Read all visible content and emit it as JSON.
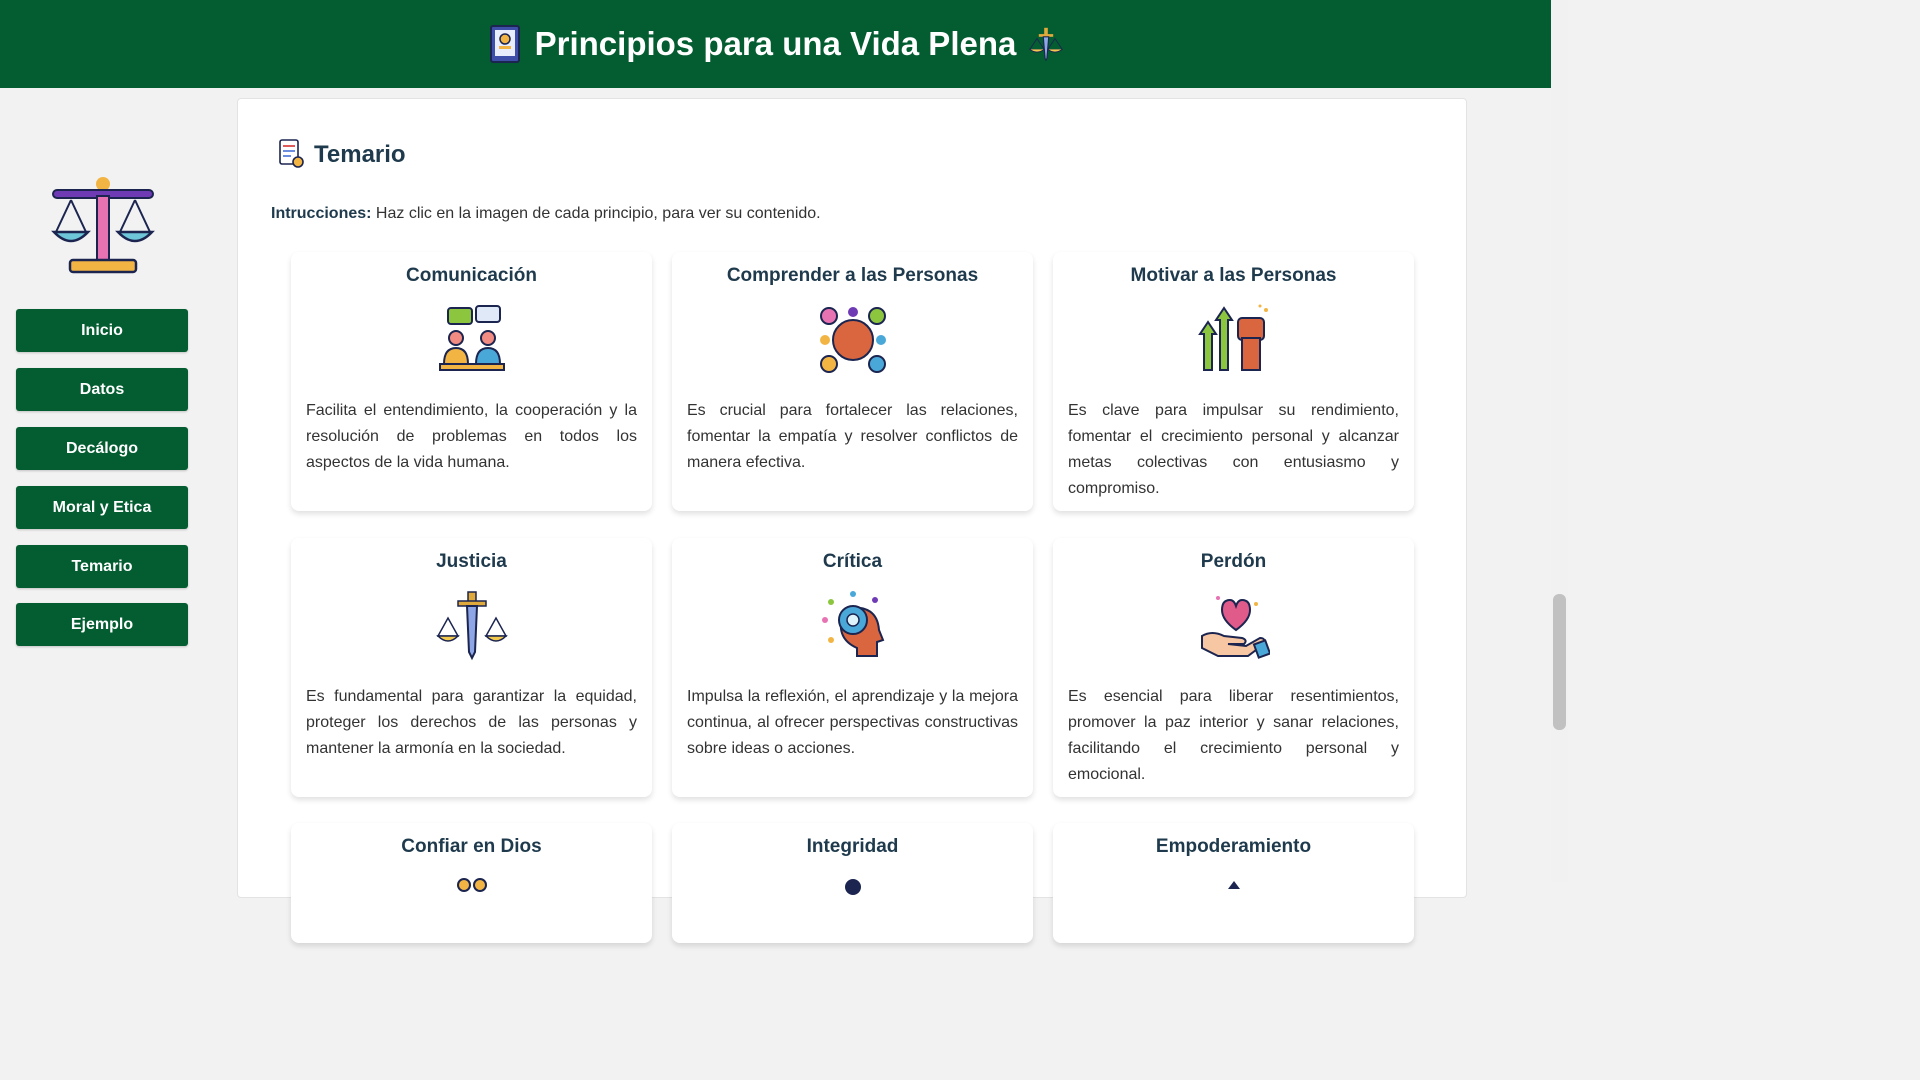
{
  "header": {
    "title": "Principios para una Vida Plena",
    "left_icon": "book-icon",
    "right_icon": "justice-sword-icon"
  },
  "sidebar": {
    "logo": "scale-icon",
    "items": [
      {
        "label": "Inicio"
      },
      {
        "label": "Datos"
      },
      {
        "label": "Decálogo"
      },
      {
        "label": "Moral y Etica"
      },
      {
        "label": "Temario"
      },
      {
        "label": "Ejemplo"
      }
    ]
  },
  "main": {
    "title": "Temario",
    "title_icon": "document-icon",
    "instructions_label": "Intrucciones:",
    "instructions_text": " Haz clic en la imagen de cada principio, para ver su contenido.",
    "cards": [
      {
        "title": "Comunicación",
        "icon": "conversation-icon",
        "text": "Facilita el entendimiento, la cooperación y la resolución de problemas en todos los aspectos de la vida humana."
      },
      {
        "title": "Comprender a las Personas",
        "icon": "connected-hands-icon",
        "text": "Es crucial para fortalecer las relaciones, fomentar la empatía y resolver conflictos de manera efectiva."
      },
      {
        "title": "Motivar a las Personas",
        "icon": "raised-fist-arrows-icon",
        "text": "Es clave para impulsar su rendimiento, fomentar el crecimiento personal y alcanzar metas colectivas con entusiasmo y compromiso."
      },
      {
        "title": "Justicia",
        "icon": "sword-scale-icon",
        "text": "Es fundamental para garantizar la equidad, proteger los derechos de las personas y mantener la armonía en la sociedad."
      },
      {
        "title": "Crítica",
        "icon": "head-gear-icon",
        "text": "Impulsa la reflexión, el aprendizaje y la mejora continua, al ofrecer perspectivas constructivas sobre ideas o acciones."
      },
      {
        "title": "Perdón",
        "icon": "heart-hand-icon",
        "text": "Es esencial para liberar resentimientos, promover la paz interior y sanar relaciones, facilitando el crecimiento personal y emocional."
      },
      {
        "title": "Confiar en Dios",
        "icon": "praying-icon",
        "text": ""
      },
      {
        "title": "Integridad",
        "icon": "integrity-icon",
        "text": ""
      },
      {
        "title": "Empoderamiento",
        "icon": "empowerment-icon",
        "text": ""
      }
    ]
  },
  "colors": {
    "brand_green": "#035d31",
    "title_navy": "#1e3a4c"
  }
}
